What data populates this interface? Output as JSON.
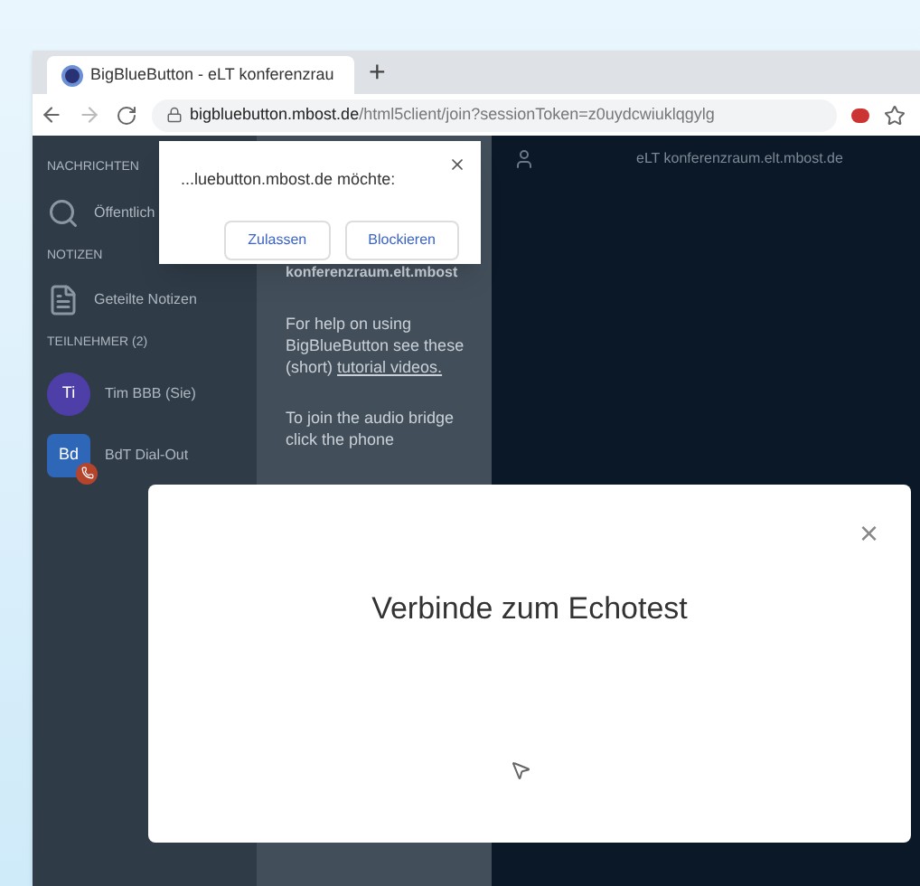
{
  "browser": {
    "tab_title": "BigBlueButton - eLT konferenzrau",
    "new_tab": "+",
    "url_host": "bigbluebutton.mbost.de",
    "url_path": "/html5client/join?sessionToken=z0uydcwiuklqgylg"
  },
  "permission_popup": {
    "text": "...luebutton.mbost.de möchte:",
    "buttons": [
      "Zulassen",
      "Blockieren"
    ]
  },
  "sidebar": {
    "sections": [
      {
        "heading": "NACHRICHTEN",
        "items": [
          {
            "kind": "chat",
            "label": "Öffentlich"
          }
        ]
      },
      {
        "heading": "NOTIZEN",
        "items": [
          {
            "kind": "notes",
            "label": "Geteilte Notizen"
          }
        ]
      },
      {
        "heading": "TEILNEHMER (2)",
        "items": [
          {
            "kind": "user",
            "avatar": "Ti",
            "label": "Tim BBB (Sie)",
            "color": "#4e3fa8"
          },
          {
            "kind": "phone",
            "avatar": "Bd",
            "label": "BdT Dial-Out",
            "color": "#2f67b8"
          }
        ]
      }
    ]
  },
  "chat_panel": {
    "title": "konferenzraum.elt.mbost",
    "help_before": "For help on using BigBlueButton see these (short) ",
    "help_link": "tutorial videos.",
    "audio_text": "To join the audio bridge click the phone"
  },
  "header": {
    "title": "eLT konferenzraum.elt.mbost.de"
  },
  "modal": {
    "title": "Verbinde zum Echotest",
    "close": "×"
  }
}
